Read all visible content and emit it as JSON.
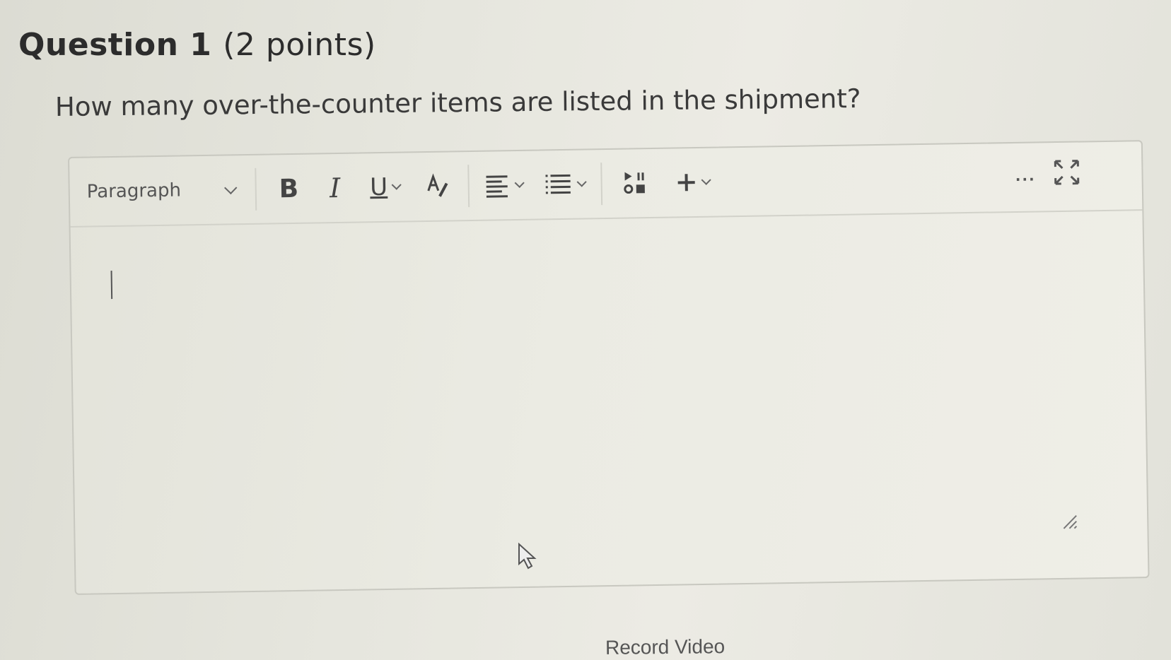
{
  "question": {
    "title": "Question 1",
    "points": "(2 points)",
    "text": "How many over-the-counter items are listed in the shipment?"
  },
  "editor": {
    "format_select": "Paragraph",
    "toolbar_icons": [
      "bold-icon",
      "italic-icon",
      "underline-icon",
      "chevron-down-icon",
      "text-color-icon",
      "align-icon",
      "chevron-down-icon",
      "list-icon",
      "chevron-down-icon",
      "media-icon",
      "plus-icon",
      "chevron-down-icon",
      "more-icon",
      "expand-icon"
    ],
    "toolbar_glyphs": {
      "bold": "B",
      "italic": "I",
      "underline": "U",
      "more": "..."
    },
    "content": ""
  },
  "footer": {
    "record_video": "Record Video"
  },
  "colors": {
    "background": "#e6e6de",
    "text": "#2e2e2e",
    "border": "#c8c8c0"
  }
}
